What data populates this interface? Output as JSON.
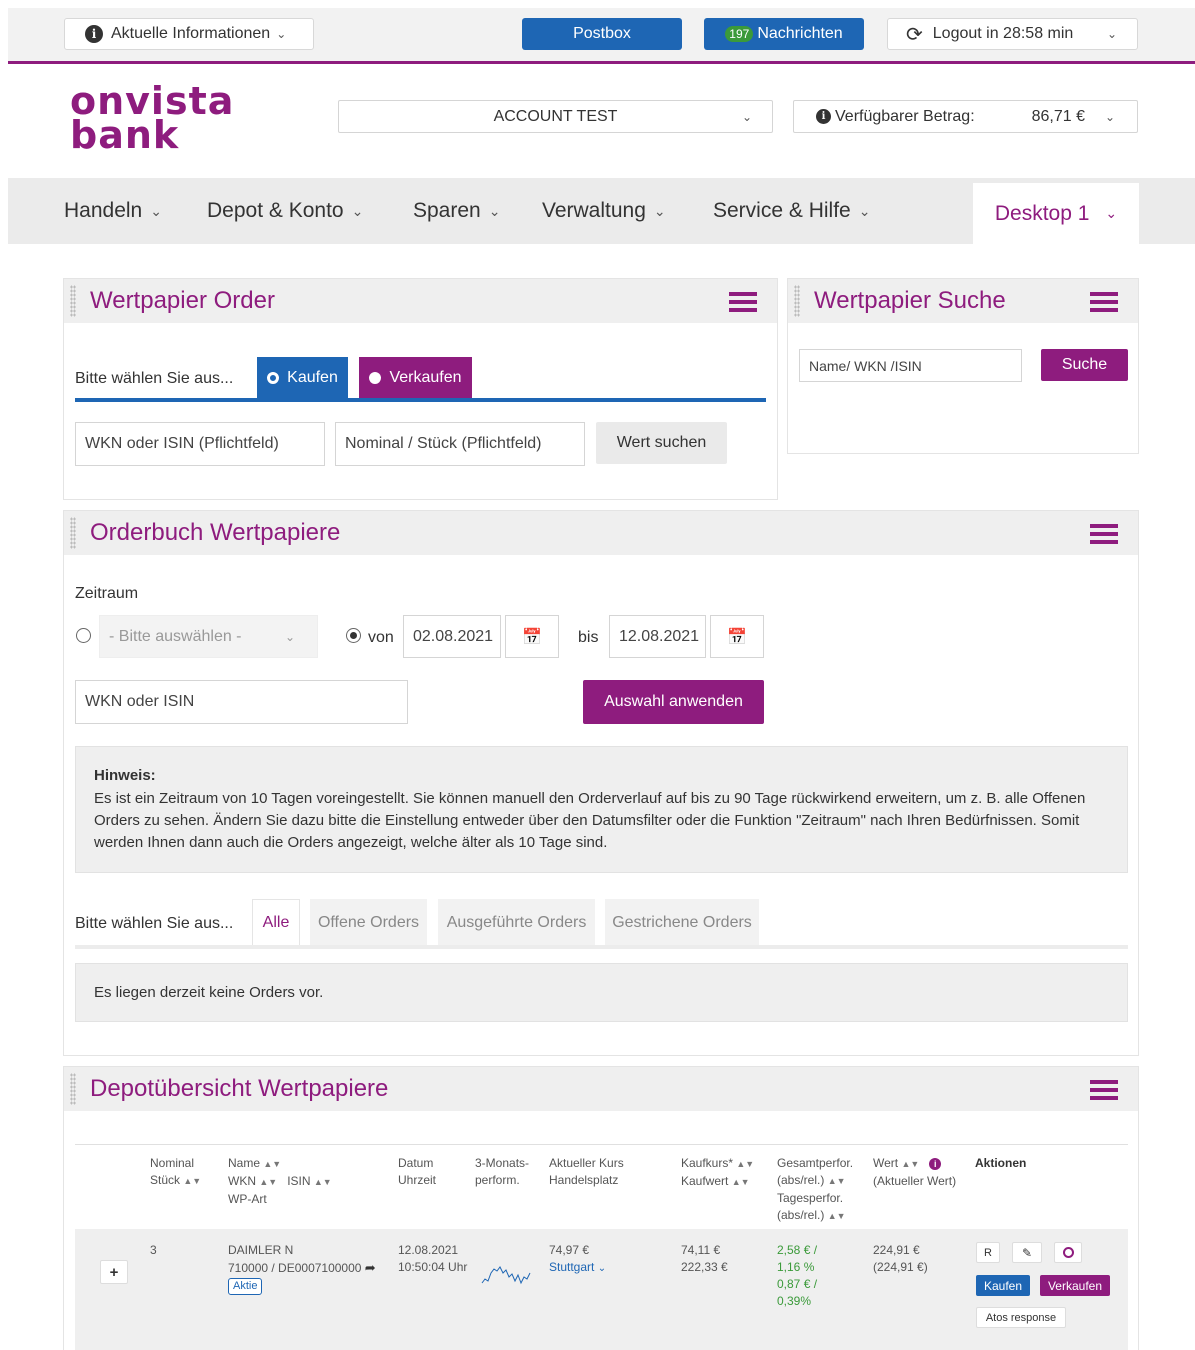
{
  "topbar": {
    "info_label": "Aktuelle Informationen",
    "postbox_label": "Postbox",
    "messages_count": "197",
    "messages_label": "Nachrichten",
    "logout_label": "Logout in 28:58 min"
  },
  "brand": {
    "line1": "onvista",
    "line2": "bank"
  },
  "account": {
    "selected": "ACCOUNT TEST",
    "available_label": "Verfügbarer Betrag:",
    "available_value": "86,71 €"
  },
  "nav": {
    "items": [
      "Handeln",
      "Depot & Konto",
      "Sparen",
      "Verwaltung",
      "Service & Hilfe"
    ],
    "desktop": "Desktop 1"
  },
  "order": {
    "title": "Wertpapier Order",
    "choose_label": "Bitte wählen Sie aus...",
    "buy_label": "Kaufen",
    "sell_label": "Verkaufen",
    "wkn_placeholder": "WKN oder ISIN (Pflichtfeld)",
    "nominal_placeholder": "Nominal / Stück (Pflichtfeld)",
    "search_button": "Wert suchen"
  },
  "search": {
    "title": "Wertpapier Suche",
    "placeholder": "Name/ WKN /ISIN",
    "button": "Suche"
  },
  "orderbook": {
    "title": "Orderbuch Wertpapiere",
    "period_label": "Zeitraum",
    "select_placeholder": "- Bitte auswählen -",
    "from_label": "von",
    "from_date": "02.08.2021",
    "to_label": "bis",
    "to_date": "12.08.2021",
    "wkn_placeholder": "WKN oder ISIN",
    "apply_button": "Auswahl anwenden",
    "hint_title": "Hinweis:",
    "hint_text": "Es ist ein Zeitraum von 10 Tagen voreingestellt. Sie können manuell den Orderverlauf auf bis zu 90 Tage rückwirkend erweitern, um z. B. alle Offenen Orders zu sehen. Ändern Sie dazu bitte die Einstellung entweder über den Datumsfilter oder die Funktion \"Zeitraum\" nach Ihren Bedürfnissen. Somit werden Ihnen dann auch die Orders angezeigt, welche älter als 10 Tage sind.",
    "choose_label": "Bitte wählen Sie aus...",
    "tabs": [
      "Alle",
      "Offene Orders",
      "Ausgeführte Orders",
      "Gestrichene Orders"
    ],
    "empty_text": "Es liegen derzeit keine Orders vor."
  },
  "depot": {
    "title": "Depotübersicht Wertpapiere",
    "headers": {
      "nominal": [
        "Nominal",
        "Stück"
      ],
      "name": [
        "Name",
        "WKN",
        "ISIN",
        "WP-Art"
      ],
      "date": [
        "Datum",
        "Uhrzeit"
      ],
      "perf3m": [
        "3-Monats-",
        "perform."
      ],
      "price": [
        "Aktueller Kurs",
        "Handelsplatz"
      ],
      "buy": [
        "Kaufkurs*",
        "Kaufwert"
      ],
      "total": [
        "Gesamtperfor.",
        "(abs/rel.)",
        "Tagesperfor.",
        "(abs/rel.)"
      ],
      "value": [
        "Wert",
        "(Aktueller Wert)"
      ],
      "actions": "Aktionen"
    },
    "row": {
      "expand": "+",
      "nominal": "3",
      "name": "DAIMLER N",
      "wkn_isin": "710000 / DE0007100000",
      "type": "Aktie",
      "date": "12.08.2021",
      "time": "10:50:04 Uhr",
      "price": "74,97 €",
      "venue": "Stuttgart",
      "buy_price": "74,11 €",
      "buy_value": "222,33 €",
      "total_abs": "2,58 € /",
      "total_rel": "1,16 %",
      "day_abs": "0,87 € /",
      "day_rel": "0,39%",
      "value": "224,91 €",
      "value_paren": "(224,91 €)",
      "btn_r": "R",
      "btn_buy": "Kaufen",
      "btn_sell": "Verkaufen",
      "btn_atos": "Atos response"
    }
  }
}
